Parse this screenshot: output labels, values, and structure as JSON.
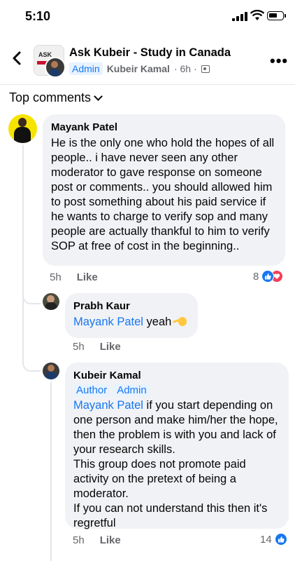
{
  "status_bar": {
    "time": "5:10"
  },
  "header": {
    "group_name": "Ask Kubeir - Study in Canada",
    "role_badge": "Admin",
    "author": "Kubeir Kamal",
    "time": "· 6h ·",
    "group_logo_text": "ASK"
  },
  "section": {
    "title": "Top comments"
  },
  "comments": [
    {
      "author": "Mayank Patel",
      "text": "He is the only one who hold the hopes of all people.. i have never seen any other moderator to gave response on someone post or comments.. you should allowed him to post something about his paid service if he wants to charge to verify sop and many people are actually thankful to him to verify SOP at free of cost in the beginning..",
      "time": "5h",
      "like_label": "Like",
      "reaction_count": "8"
    },
    {
      "author": "Prabh Kaur",
      "mention": "Mayank Patel",
      "text": " yeah",
      "time": "5h",
      "like_label": "Like"
    },
    {
      "author": "Kubeir Kamal",
      "badges": [
        "Author",
        "Admin"
      ],
      "mention": "Mayank Patel",
      "text": " if you start depending on one person and make him/her the hope, then the problem is with you and lack of your research skills.\nThis group does not promote paid activity on the pretext of being a moderator.\nIf you can not understand this then it's regretful",
      "time": "5h",
      "like_label": "Like",
      "reaction_count": "14"
    }
  ],
  "colors": {
    "accent": "#1877f2",
    "bubble": "#f0f2f5",
    "meta": "#65676b",
    "love": "#f33e58"
  },
  "icons": [
    "back-arrow-icon",
    "more-icon",
    "friends-privacy-icon",
    "chevron-down-icon",
    "like-reaction-icon",
    "love-reaction-icon",
    "wave-emoji-icon"
  ]
}
